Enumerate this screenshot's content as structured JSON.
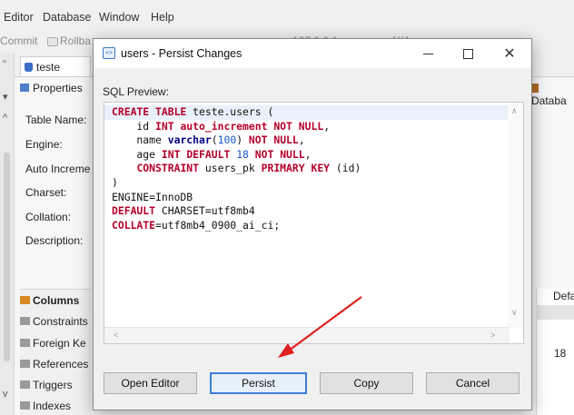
{
  "menu": [
    "Editor",
    "Database",
    "Window",
    "Help"
  ],
  "toolbar": {
    "commit_label": "Commit",
    "rollback_label": "Rollba",
    "ip_fragment": "127.0.0.1",
    "na_fragment": "N/A"
  },
  "editor_tab": {
    "label": "teste"
  },
  "properties_tab": {
    "label": "Properties"
  },
  "right_tab": {
    "label": "Databa"
  },
  "fields": [
    "Table Name:",
    "Engine:",
    "Auto Increme",
    "Charset:",
    "Collation:",
    "Description:"
  ],
  "bottom_tabs": [
    "Columns",
    "Constraints",
    "Foreign Ke",
    "References",
    "Triggers",
    "Indexes"
  ],
  "grid": {
    "header": "Defa",
    "cell": "18"
  },
  "dialog": {
    "title": "users - Persist Changes",
    "sql_label": "SQL Preview:",
    "sql_lines": [
      [
        {
          "t": "kw",
          "v": "CREATE TABLE "
        },
        {
          "t": "plain",
          "v": "teste.users ("
        }
      ],
      [
        {
          "t": "plain",
          "v": "    id "
        },
        {
          "t": "kw",
          "v": "INT "
        },
        {
          "t": "kw",
          "v": "auto_increment "
        },
        {
          "t": "kw",
          "v": "NOT NULL"
        },
        {
          "t": "plain",
          "v": ","
        }
      ],
      [
        {
          "t": "plain",
          "v": "    name "
        },
        {
          "t": "type",
          "v": "varchar"
        },
        {
          "t": "plain",
          "v": "("
        },
        {
          "t": "num",
          "v": "100"
        },
        {
          "t": "plain",
          "v": ") "
        },
        {
          "t": "kw",
          "v": "NOT NULL"
        },
        {
          "t": "plain",
          "v": ","
        }
      ],
      [
        {
          "t": "plain",
          "v": "    age "
        },
        {
          "t": "kw",
          "v": "INT "
        },
        {
          "t": "kw",
          "v": "DEFAULT "
        },
        {
          "t": "num",
          "v": "18 "
        },
        {
          "t": "kw",
          "v": "NOT NULL"
        },
        {
          "t": "plain",
          "v": ","
        }
      ],
      [
        {
          "t": "plain",
          "v": "    "
        },
        {
          "t": "kw",
          "v": "CONSTRAINT "
        },
        {
          "t": "plain",
          "v": "users_pk "
        },
        {
          "t": "kw",
          "v": "PRIMARY KEY "
        },
        {
          "t": "plain",
          "v": "(id)"
        }
      ],
      [
        {
          "t": "plain",
          "v": ")"
        }
      ],
      [
        {
          "t": "plain",
          "v": "ENGINE=InnoDB"
        }
      ],
      [
        {
          "t": "kw",
          "v": "DEFAULT "
        },
        {
          "t": "plain",
          "v": "CHARSET=utf8mb4"
        }
      ],
      [
        {
          "t": "kw",
          "v": "COLLATE"
        },
        {
          "t": "plain",
          "v": "=utf8mb4_0900_ai_ci;"
        }
      ]
    ],
    "buttons": {
      "open_editor": "Open Editor",
      "persist": "Persist",
      "copy": "Copy",
      "cancel": "Cancel"
    }
  },
  "colors": {
    "keyword": "#b5002a",
    "type": "#000080",
    "number": "#1a56c9",
    "annotation_arrow": "#e02020",
    "default_button_border": "#3d7fd6"
  }
}
